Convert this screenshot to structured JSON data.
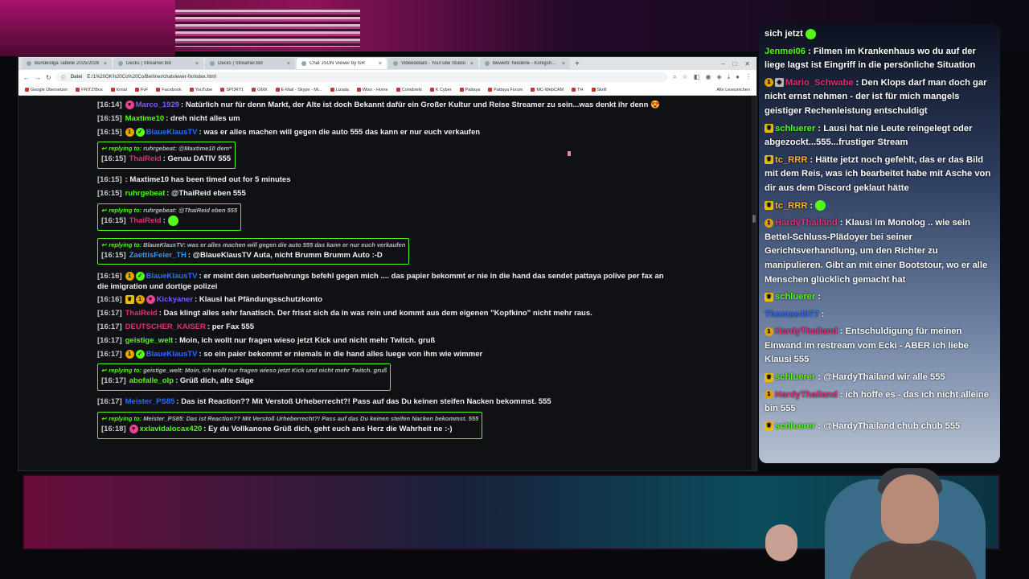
{
  "browser": {
    "tabs": [
      {
        "label": "Bundesliga Tabelle 2025/2026",
        "active": false
      },
      {
        "label": "Decks | Streamer.bot",
        "active": false
      },
      {
        "label": "Decks | Streamer.bot",
        "active": false
      },
      {
        "label": "Chat JSON Viewer by tsR",
        "active": true
      },
      {
        "label": "Videodetails - YouTube Studio",
        "active": false
      },
      {
        "label": "Bewerb: Niederle - Königshaus",
        "active": false
      }
    ],
    "new_tab": "+",
    "address": {
      "scheme": "Datei",
      "url": "E:/1%20OK%20Co%20Co/Berliner/chatviewer-fix/index.html"
    },
    "bookmarks": [
      "Google Übersetzer",
      "FRITZ!Box",
      "fonial",
      "FvF",
      "Facebook",
      "YouTube",
      "SPORT1",
      "GMX",
      "E-Mail - Skype - Mi...",
      "Lizada",
      "Wiso - Home",
      "Comdirekt",
      "K Cyber",
      "Pattaya",
      "Pattaya Forum",
      "MC-WebCAM",
      "TH",
      "Skrill"
    ],
    "bookmarks_end": "Alle Lesezeichen"
  },
  "chat": {
    "reply_label": "replying to:",
    "messages": [
      {
        "type": "msg",
        "ts": "[16:14]",
        "badges": [
          "heart"
        ],
        "user": "Marco_1929",
        "color": "#7b5cff",
        "text": ": Natürlich nur für denn Markt, der Alte ist doch Bekannt dafür ein Großer Kultur und Reise Streamer zu sein...was denkt ihr denn 😍"
      },
      {
        "type": "msg",
        "ts": "[16:15]",
        "badges": [],
        "user": "Maxtime10",
        "color": "#53fc18",
        "text": ": dreh nicht alles um"
      },
      {
        "type": "msg",
        "ts": "[16:15]",
        "badges": [
          "sub",
          "verified"
        ],
        "user": "BlaueKlausTV",
        "color": "#2f6bff",
        "text": ": was er alles machen will gegen die auto 555 das kann er nur euch verkaufen"
      },
      {
        "type": "reply",
        "reply_user": "ruhrgebeat",
        "reply_text": "@Maxtime10 dem*",
        "ts": "[16:15]",
        "badges": [],
        "user": "ThaiReid",
        "color": "#e0307a",
        "text": ": Genau DATIV 555"
      },
      {
        "type": "msg",
        "ts": "[16:15]",
        "badges": [],
        "user": "",
        "color": "#ffffff",
        "text": ": Maxtime10 has been timed out for 5 minutes"
      },
      {
        "type": "msg",
        "ts": "[16:15]",
        "badges": [],
        "user": "ruhrgebeat",
        "color": "#53fc18",
        "text": ": @ThaiReid eben 555"
      },
      {
        "type": "reply",
        "reply_user": "ruhrgebeat",
        "reply_text": "@ThaiReid eben 555",
        "ts": "[16:15]",
        "badges": [],
        "user": "ThaiReid",
        "color": "#e0307a",
        "text": ":",
        "emote": true
      },
      {
        "type": "reply",
        "reply_user": "BlaueKlausTV",
        "reply_text": "was er alles machen will gegen die auto 555 das kann er nur euch verkaufen",
        "ts": "[16:15]",
        "badges": [],
        "user": "ZaettisFeier_TH",
        "color": "#2f9bff",
        "text": ": @BlaueKlausTV Auta, nicht Brumm Brumm Auto :-D"
      },
      {
        "type": "wrap",
        "ts": "[16:16]",
        "badges": [
          "sub",
          "verified"
        ],
        "user": "BlaueKlausTV",
        "color": "#2f6bff",
        "text": ": er meint den ueberfuehrungs befehl gegen mich .... das papier bekommt er nie in die hand das sendet pattaya polive per fax an die imigration und dortige polizei"
      },
      {
        "type": "msg",
        "ts": "[16:16]",
        "badges": [
          "crown",
          "sub",
          "heart"
        ],
        "user": "Kickyaner",
        "color": "#7b5cff",
        "text": ": Klausi hat Pfändungsschutzkonto"
      },
      {
        "type": "msg",
        "ts": "[16:17]",
        "badges": [],
        "user": "ThaiReid",
        "color": "#e0307a",
        "text": ": Das klingt alles sehr fanatisch. Der frisst sich da in was rein und kommt aus dem eigenen \"Kopfkino\" nicht mehr raus."
      },
      {
        "type": "msg",
        "ts": "[16:17]",
        "badges": [],
        "user": "DEUTSCHER_KAISER",
        "color": "#e0307a",
        "text": ": per Fax 555"
      },
      {
        "type": "msg",
        "ts": "[16:17]",
        "badges": [],
        "user": "geistige_welt",
        "color": "#53fc18",
        "text": ": Moin, ich wollt nur fragen wieso jetzt Kick und nicht mehr Twitch. gruß"
      },
      {
        "type": "msg",
        "ts": "[16:17]",
        "badges": [
          "sub",
          "verified"
        ],
        "user": "BlaueKlausTV",
        "color": "#2f6bff",
        "text": ": so ein paier bekommt er niemals in die hand alles luege von ihm wie wimmer"
      },
      {
        "type": "reply",
        "reply_user": "geistige_welt",
        "reply_text": "Moin, ich wollt nur fragen wieso jetzt Kick und nicht mehr Twitch. gruß",
        "ts": "[16:17]",
        "badges": [],
        "user": "abofalle_olp",
        "color": "#53fc18",
        "text": ": Grüß dich, alte Säge"
      },
      {
        "type": "msg",
        "ts": "[16:17]",
        "badges": [],
        "user": "Meister_PS85",
        "color": "#2f6bff",
        "text": ": Das ist Reaction?? Mit Verstoß Urheberrecht?! Pass auf das Du keinen steifen Nacken bekommst. 555"
      },
      {
        "type": "reply",
        "reply_user": "Meister_PS85",
        "reply_text": "Das ist Reaction?? Mit Verstoß Urheberrecht?! Pass auf das Du keinen steifen Nacken bekommst. 555",
        "ts": "[16:18]",
        "badges": [
          "heart"
        ],
        "user": "xxlavidalocax420",
        "color": "#53fc18",
        "text": ": Ey du Vollkanone Grüß dich, geht euch ans Herz die Wahrheit ne :-)"
      }
    ]
  },
  "side_chat": {
    "messages": [
      {
        "badges": [],
        "user": "",
        "color": "#ffffff",
        "text": "sich jetzt",
        "emote": true
      },
      {
        "badges": [],
        "user": "Jenmei06",
        "color": "#53fc18",
        "text": ": Filmen im Krankenhaus wo du auf der liege lagst ist Eingriff in die persönliche Situation"
      },
      {
        "badges": [
          "sub",
          "og"
        ],
        "user": "Mario_Schwabe",
        "color": "#e0307a",
        "text": ": Den Klops darf man doch gar nicht ernst nehmen - der ist für mich mangels geistiger Rechenleistung entschuldigt"
      },
      {
        "badges": [
          "crown"
        ],
        "user": "schluerer",
        "color": "#53fc18",
        "text": ": Lausi hat nie Leute reingelegt oder abgezockt...555...frustiger Stream"
      },
      {
        "badges": [
          "crown"
        ],
        "user": "tc_RRR",
        "color": "#ffb020",
        "text": ": Hätte jetzt noch gefehlt, das er das Bild mit dem Reis, was ich bearbeitet habe mit Asche von dir aus dem Discord geklaut hätte"
      },
      {
        "badges": [
          "crown"
        ],
        "user": "tc_RRR",
        "color": "#ffb020",
        "text": ":",
        "emote": true
      },
      {
        "badges": [
          "sub"
        ],
        "user": "HardyThailand",
        "color": "#e0307a",
        "text": ": Klausi im Monolog .. wie sein Bettel-Schluss-Plädoyer bei seiner Gerichtsverhandlung, um den Richter zu manipulieren. Gibt an mit einer Bootstour, wo er alle Menschen glücklich gemacht hat"
      },
      {
        "badges": [
          "crown"
        ],
        "user": "schluerer",
        "color": "#53fc18",
        "text": ":"
      },
      {
        "badges": [],
        "user": "Thomas4077",
        "color": "#2f6bff",
        "text": ":"
      },
      {
        "badges": [
          "sub"
        ],
        "user": "HardyThailand",
        "color": "#e0307a",
        "text": ": Entschuldigung für meinen Einwand im restream vom Ecki - ABER ich liebe Klausi 555"
      },
      {
        "badges": [
          "crown"
        ],
        "user": "schluerer",
        "color": "#53fc18",
        "text": ": @HardyThailand wir alle 555"
      },
      {
        "badges": [
          "sub"
        ],
        "user": "HardyThailand",
        "color": "#e0307a",
        "text": ": ich hoffe es - das ich nicht alleine bin 555"
      },
      {
        "badges": [
          "crown"
        ],
        "user": "schluerer",
        "color": "#53fc18",
        "text": ": @HardyThailand chub chub 555"
      }
    ]
  }
}
